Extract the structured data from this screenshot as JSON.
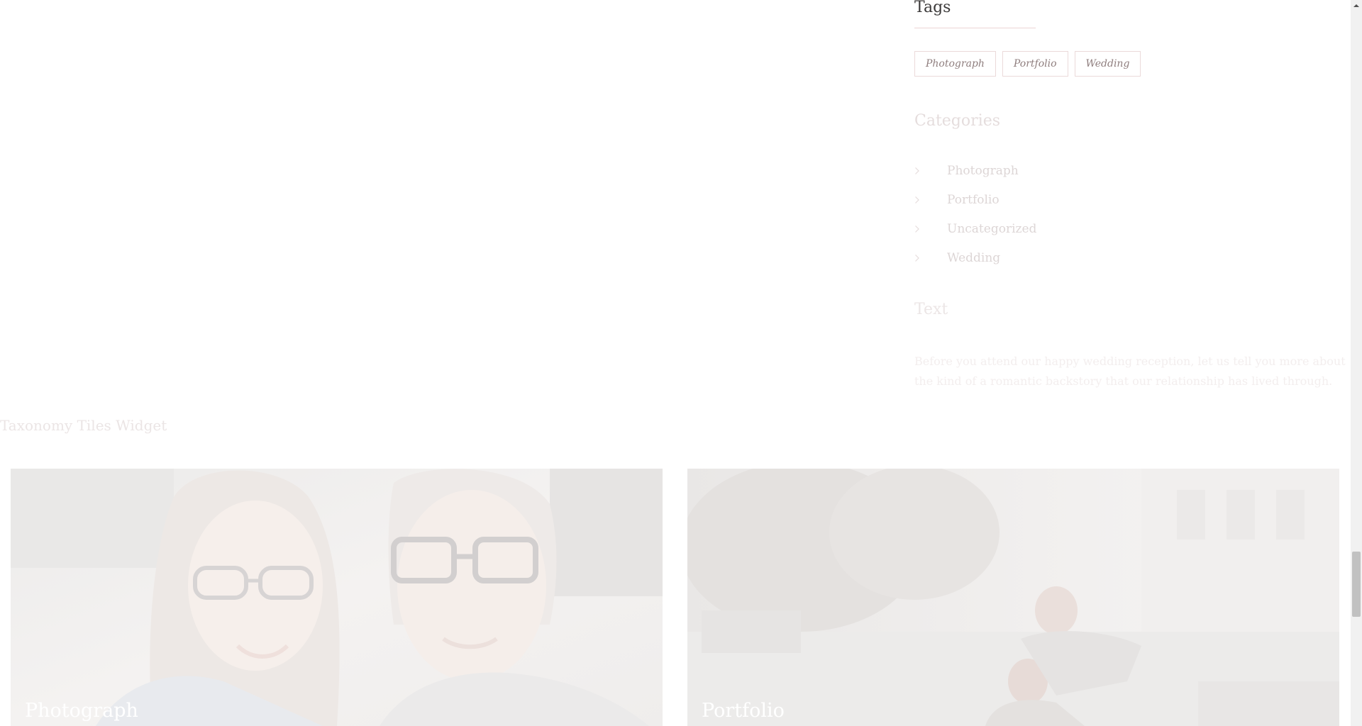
{
  "sidebar": {
    "tags": {
      "title": "Tags",
      "items": [
        "Photograph",
        "Portfolio",
        "Wedding"
      ]
    },
    "categories": {
      "title": "Categories",
      "items": [
        "Photograph",
        "Portfolio",
        "Uncategorized",
        "Wedding"
      ]
    },
    "text_widget": {
      "title": "Text",
      "body": "Before you attend our happy wedding reception, let us tell you more about the kind of a romantic backstory that our relationship has lived through."
    }
  },
  "taxonomy_tiles": {
    "heading": "Taxonomy Tiles Widget",
    "tiles": [
      {
        "label": "Photograph"
      },
      {
        "label": "Portfolio"
      }
    ]
  },
  "colors": {
    "accent_underline": "#ecd4d4",
    "tag_text": "#8f7e7e",
    "tag_border": "#ebdada"
  },
  "icons": {
    "category_bullet": "chevron-right-icon",
    "scroll_up": "arrow-up-icon"
  }
}
